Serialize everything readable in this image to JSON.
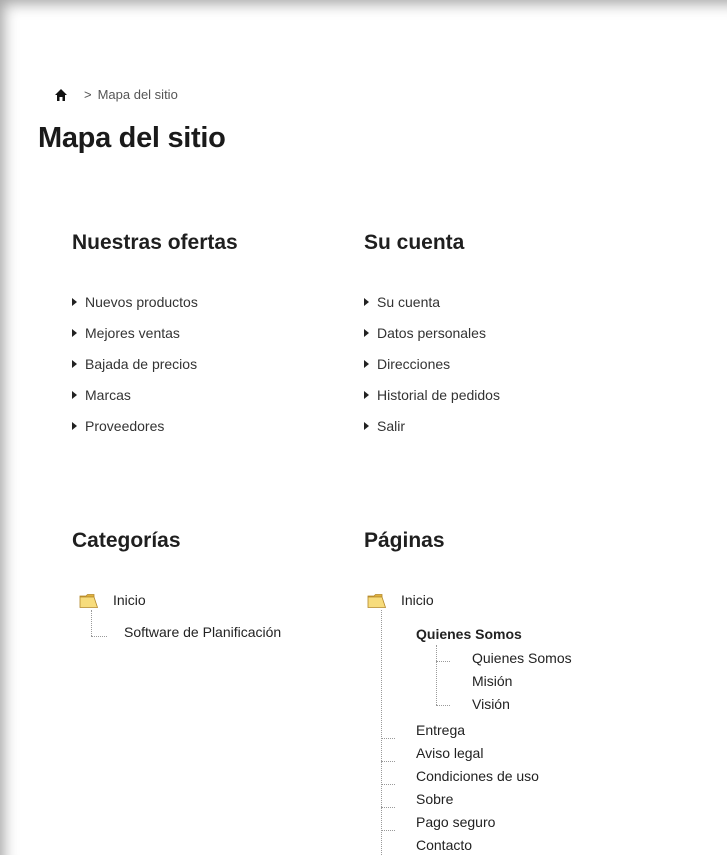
{
  "breadcrumb": {
    "home_icon": "home-icon",
    "separator": ">",
    "current": "Mapa del sitio"
  },
  "page_title": "Mapa del sitio",
  "offers": {
    "heading": "Nuestras ofertas",
    "items": [
      "Nuevos productos",
      "Mejores ventas",
      "Bajada de precios",
      "Marcas",
      "Proveedores"
    ]
  },
  "account": {
    "heading": "Su cuenta",
    "items": [
      "Su cuenta",
      "Datos personales",
      "Direcciones",
      "Historial de pedidos",
      "Salir"
    ]
  },
  "categories": {
    "heading": "Categorías",
    "root": "Inicio",
    "children": [
      "Software de Planificación"
    ]
  },
  "pages": {
    "heading": "Páginas",
    "root": "Inicio",
    "group_label": "Quienes Somos",
    "group_children": [
      "Quienes Somos",
      "Misión",
      "Visión"
    ],
    "items": [
      "Entrega",
      "Aviso legal",
      "Condiciones de uso",
      "Sobre",
      "Pago seguro",
      "Contacto"
    ]
  },
  "colors": {
    "text": "#333333",
    "heading": "#1f1f1f",
    "folder": "#f2cf63",
    "tree_line": "#9a9a9a"
  }
}
